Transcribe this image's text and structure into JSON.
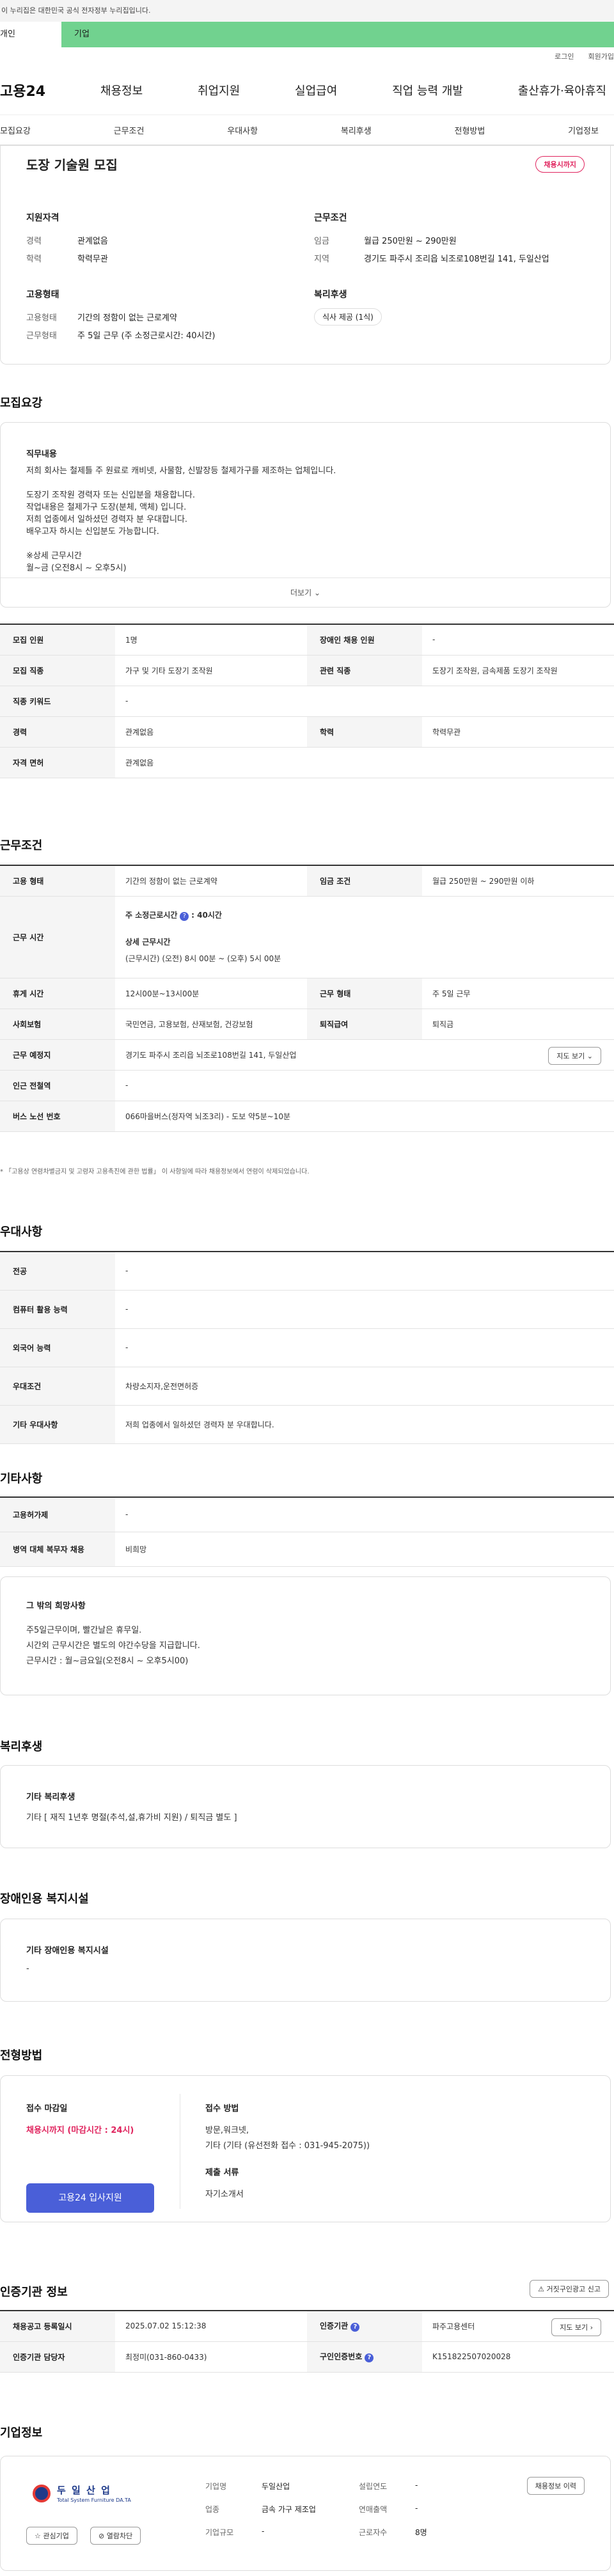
{
  "banner": {
    "text": "이 누리집은 대한민국 공식 전자정부 누리집입니다."
  },
  "top_tabs": [
    "개인",
    "기업"
  ],
  "util": {
    "login": "로그인",
    "signup": "회원가입"
  },
  "logo": "고용24",
  "gnb": [
    "채용정보",
    "취업지원",
    "실업급여",
    "직업 능력 개발",
    "출산휴가·육아휴직"
  ],
  "subnav": [
    "모집요강",
    "근무조건",
    "우대사항",
    "복리후생",
    "전형방법",
    "기업정보"
  ],
  "headline": {
    "title": "도장 기술원 모집",
    "badge": "채용시까지"
  },
  "summary": {
    "qual_title": "지원자격",
    "exp_label": "경력",
    "exp_val": "관계없음",
    "edu_label": "학력",
    "edu_val": "학력무관",
    "cond_title": "근무조건",
    "wage_label": "임금",
    "wage_val": "월급 250만원 ~ 290만원",
    "area_label": "지역",
    "area_val": "경기도 파주시 조리읍 뇌조로108번길 141, 두일산업",
    "form_title": "고용형태",
    "emp_label": "고용형태",
    "emp_val": "기간의 정함이 없는 근로계약",
    "work_label": "근무형태",
    "work_val": "주 5일 근무 (주 소정근로시간: 40시간)",
    "welfare_title": "복리후생",
    "welfare_pill": "식사 제공 (1식)"
  },
  "recruit": {
    "title": "모집요강",
    "duty_title": "직무내용",
    "duty_lines": [
      "저희 회사는 철제틀 주 원료로 캐비넷, 사물함, 신발장등 철제가구를 제조하는 업체입니다.",
      "",
      "도장기 조작원 경력자 또는 신입분을 채용합니다.",
      "작업내용은 철제가구 도장(분체, 액체) 입니다.",
      "저희 업종에서 일하셨던 경력자 분 우대합니다.",
      "배우고자 하시는 신입분도 가능합니다.",
      "",
      "※상세 근무시간",
      "월~금 (오전8시 ~ 오후5시)"
    ],
    "more": "더보기",
    "rows": {
      "count_label": "모집 인원",
      "count_val": "1명",
      "disabled_label": "장애인 채용 인원",
      "disabled_val": "-",
      "job_label": "모집 직종",
      "job_val": "가구 및 기타 도장기 조작원",
      "rel_label": "관련 직종",
      "rel_val": "도장기 조작원, 금속제품 도장기 조작원",
      "kw_label": "직종 키워드",
      "kw_val": "-",
      "exp_label": "경력",
      "exp_val": "관계없음",
      "edu_label": "학력",
      "edu_val": "학력무관",
      "lic_label": "자격 면허",
      "lic_val": "관계없음"
    }
  },
  "conditions": {
    "title": "근무조건",
    "emp_label": "고용 형태",
    "emp_val": "기간의 정함이 없는 근로계약",
    "wage_label": "임금 조건",
    "wage_val": "월급 250만원 ~ 290만원 이하",
    "time_label": "근무 시간",
    "time_main": "주 소정근로시간",
    "time_hours": ": 40시간",
    "time_detail_title": "상세 근무시간",
    "time_detail": "(근무시간) (오전) 8시 00분 ~ (오후) 5시 00분",
    "break_label": "휴게 시간",
    "break_val": "12시00분~13시00분",
    "form_label": "근무 형태",
    "form_val": "주 5일 근무",
    "ins_label": "사회보험",
    "ins_val": "국민연금, 고용보험, 산재보험, 건강보험",
    "ret_label": "퇴직급여",
    "ret_val": "퇴직금",
    "place_label": "근무 예정지",
    "place_val": "경기도 파주시 조리읍 뇌조로108번길 141, 두일산업",
    "map_btn": "지도 보기",
    "subway_label": "인근 전철역",
    "subway_val": "-",
    "bus_label": "버스 노선 번호",
    "bus_val": "066마을버스(정자역 뇌조3리) - 도보 약5분~10분",
    "note": "* 「고용상 연령차별금지 및 고령자 고용촉진에 관한 법률」 이 사항일에 따라 채용정보에서 연령이 삭제되었습니다."
  },
  "preference": {
    "title": "우대사항",
    "major_label": "전공",
    "major_val": "-",
    "pc_label": "컴퓨터 활용 능력",
    "pc_val": "-",
    "lang_label": "외국어 능력",
    "lang_val": "-",
    "pref_label": "우대조건",
    "pref_val": "차량소지자,운전면허증",
    "etc_label": "기타 우대사항",
    "etc_val": "저희 업종에서 일하셨던 경력자 분 우대합니다."
  },
  "etc": {
    "title": "기타사항",
    "hire_label": "고용허가제",
    "hire_val": "-",
    "mil_label": "병역 대체 복무자 채용",
    "mil_val": "비희망",
    "other_title": "그 밖의 희망사항",
    "other_lines": [
      "주5일근무이며, 빨간날은 휴무일.",
      "시간외 근무시간은 별도의 야간수당을 지급합니다.",
      "근무시간 : 월~금요일(오전8시 ~ 오후5시00)"
    ]
  },
  "welfare": {
    "title": "복리후생",
    "card_title": "기타 복리후생",
    "card_val": "기타 [ 재직 1년후 명절(추석,설,휴가비 지원) / 퇴직금 별도 ]"
  },
  "disabled": {
    "title": "장애인용 복지시설",
    "card_title": "기타 장애인용 복지시설",
    "card_val": "-"
  },
  "selection": {
    "title": "전형방법",
    "deadline_title": "접수 마감일",
    "deadline_val": "채용시까지 (마감시간 : 24시)",
    "apply_btn": "고용24 입사지원",
    "method_title": "접수 방법",
    "method_line1": "방문,워크넷,",
    "method_line2": "기타 (기타 (유선전화 접수 : 031-945-2075))",
    "docs_title": "제출 서류",
    "docs_val": "자기소개서"
  },
  "agency": {
    "title": "인증기관 정보",
    "report_btn": "거짓구인광고 신고",
    "reg_label": "채용공고 등록일시",
    "reg_val": "2025.07.02 15:12:38",
    "org_label": "인증기관",
    "org_val": "파주고용센터",
    "map_btn": "지도 보기",
    "mgr_label": "인증기관 담당자",
    "mgr_val": "최정미(031-860-0433)",
    "num_label": "구인인증번호",
    "num_val": "K151822507020028"
  },
  "company": {
    "title": "기업정보",
    "logo_name": "두 일 산 업",
    "logo_sub": "Total System Furniture DA.TA",
    "fav_btn": "관심기업",
    "block_btn": "열람차단",
    "name_label": "기업명",
    "name_val": "두일산업",
    "ind_label": "업종",
    "ind_val": "금속 가구 제조업",
    "size_label": "기업규모",
    "size_val": "-",
    "year_label": "설립연도",
    "year_val": "-",
    "sales_label": "연매출액",
    "sales_val": "-",
    "emp_label": "근로자수",
    "emp_val": "8명",
    "info_btn": "채용정보 이력"
  },
  "colors": {
    "accent": "#4a5fd8",
    "badge": "#e0245e",
    "topbar": "#71d28f",
    "deadline": "#e0245e"
  }
}
